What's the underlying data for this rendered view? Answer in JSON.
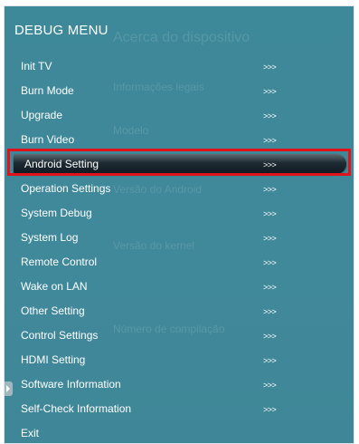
{
  "window": {
    "title": "DEBUG MENU"
  },
  "background_ghost": {
    "title": "Acerca do dispositivo",
    "line1": "Informações legais",
    "line2": "Modelo",
    "line3": "Versão do Android",
    "line4": "Versão do kernel",
    "line5": "Número de compilação"
  },
  "menu": {
    "arrow_text": ">>>",
    "selected_index": 4,
    "items": [
      {
        "label": "Init TV"
      },
      {
        "label": "Burn Mode"
      },
      {
        "label": "Upgrade"
      },
      {
        "label": "Burn Video"
      },
      {
        "label": "Android Setting"
      },
      {
        "label": "Operation Settings"
      },
      {
        "label": "System Debug"
      },
      {
        "label": "System Log"
      },
      {
        "label": "Remote Control"
      },
      {
        "label": "Wake on LAN"
      },
      {
        "label": "Other Setting"
      },
      {
        "label": "Control Settings"
      },
      {
        "label": "HDMI Setting"
      },
      {
        "label": "Software Information"
      },
      {
        "label": "Self-Check Information"
      },
      {
        "label": "Exit"
      }
    ]
  },
  "colors": {
    "panel_bg": "#3f8a9b",
    "selection_border": "#e11219",
    "selection_bar": "#1e2a32",
    "text": "#ffffff"
  },
  "icons": {
    "side_tab": "triangle-right-icon"
  }
}
